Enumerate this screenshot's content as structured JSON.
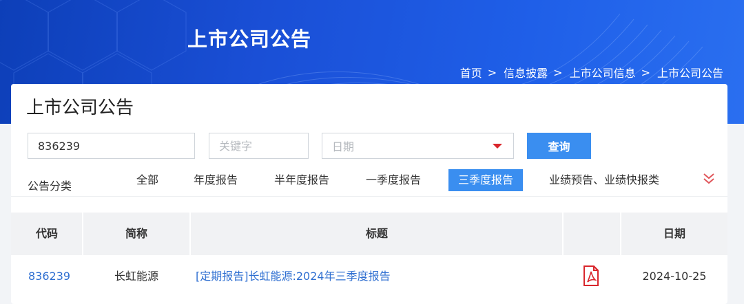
{
  "banner": {
    "title": "上市公司公告"
  },
  "breadcrumb": {
    "items": [
      "首页",
      "信息披露",
      "上市公司信息",
      "上市公司公告"
    ],
    "separator": ">"
  },
  "card": {
    "title": "上市公司公告"
  },
  "search": {
    "code_value": "836239",
    "keyword_placeholder": "关键字",
    "date_placeholder": "日期",
    "query_label": "查询"
  },
  "categories": {
    "label": "公告分类",
    "items": [
      "全部",
      "年度报告",
      "半年度报告",
      "一季度报告",
      "三季度报告",
      "业绩预告、业绩快报类"
    ],
    "active": "三季度报告"
  },
  "table": {
    "headers": [
      "代码",
      "简称",
      "标题",
      "日期"
    ],
    "rows": [
      {
        "code": "836239",
        "name": "长虹能源",
        "title": "[定期报告]长虹能源:2024年三季度报告",
        "file_icon": "pdf-icon",
        "date": "2024-10-25"
      }
    ]
  },
  "colors": {
    "accent": "#3a8ef0",
    "banner": "#1a4fd6",
    "link": "#2f6fd1",
    "pdf": "#d9262c"
  }
}
